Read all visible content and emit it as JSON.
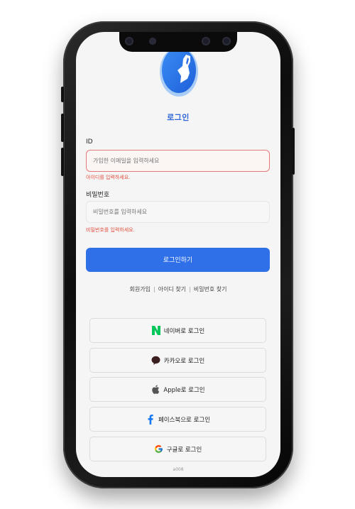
{
  "login": {
    "title": "로그인",
    "id_label": "ID",
    "id_placeholder": "가입한 이메일을 입력하세요",
    "id_error": "아이디를 입력하세요.",
    "pw_label": "비밀번호",
    "pw_placeholder": "비밀번호를 입력하세요",
    "pw_error": "비밀번호를 입력하세요.",
    "submit_label": "로그인하기"
  },
  "links": {
    "signup": "회원가입",
    "find_id": "아이디 찾기",
    "find_pw": "비밀번호 찾기",
    "separator": "|"
  },
  "social": [
    {
      "label": "네이버로 로그인",
      "icon": "naver-icon"
    },
    {
      "label": "카카오로 로그인",
      "icon": "kakao-icon"
    },
    {
      "label": "Apple로 로그인",
      "icon": "apple-icon"
    },
    {
      "label": "페이스북으로 로그인",
      "icon": "facebook-icon"
    },
    {
      "label": "구글로 로그인",
      "icon": "google-icon"
    }
  ],
  "footer": "a008",
  "colors": {
    "accent": "#2f6fe8",
    "error": "#e0503f",
    "naver": "#03c75a",
    "facebook": "#1877f2"
  }
}
